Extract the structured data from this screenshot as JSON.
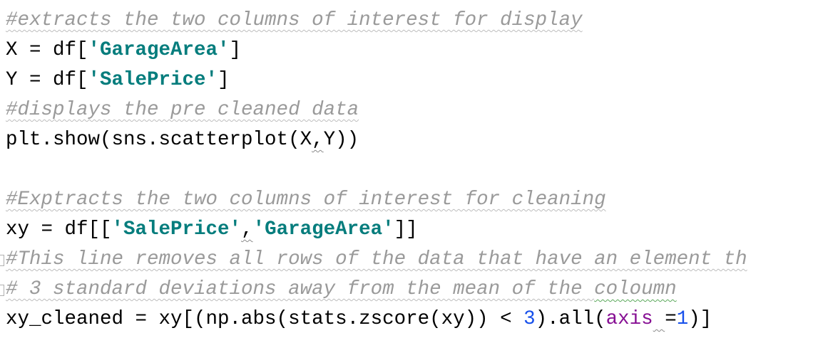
{
  "editor": {
    "line1": {
      "comment": "#extracts the two columns of interest for display"
    },
    "line2": {
      "pre": "X = df[",
      "str": "'GarageArea'",
      "post": "]"
    },
    "line3": {
      "pre": "Y = df[",
      "str": "'SalePrice'",
      "post": "]"
    },
    "line4": {
      "comment": "#displays the pre cleaned data"
    },
    "line5": {
      "pre": "plt.show(sns.scatterplot(X",
      "comma": ",",
      "post": "Y))"
    },
    "line7": {
      "comment": "#Exptracts the two columns of interest for cleaning"
    },
    "line8": {
      "pre": "xy = df[[",
      "str1": "'SalePrice'",
      "comma": ",",
      "str2": "'GarageArea'",
      "post": "]]"
    },
    "line9": {
      "comment": "#This line removes all rows of the data that have an element th"
    },
    "line10": {
      "comment_a": "# 3 standard deviations away from the mean of the ",
      "comment_b": "coloumn"
    },
    "line11": {
      "pre": "xy_cleaned = xy[(np.abs(stats.zscore(xy)) < ",
      "num1": "3",
      "mid": ").all(",
      "kw": "axis",
      "space": " ",
      "eq": "=",
      "num2": "1",
      "post": ")]"
    }
  },
  "colors": {
    "comment": "#9a9a9a",
    "string": "#067d7d",
    "number": "#1750eb",
    "keyword_arg": "#871094",
    "text": "#000000"
  }
}
